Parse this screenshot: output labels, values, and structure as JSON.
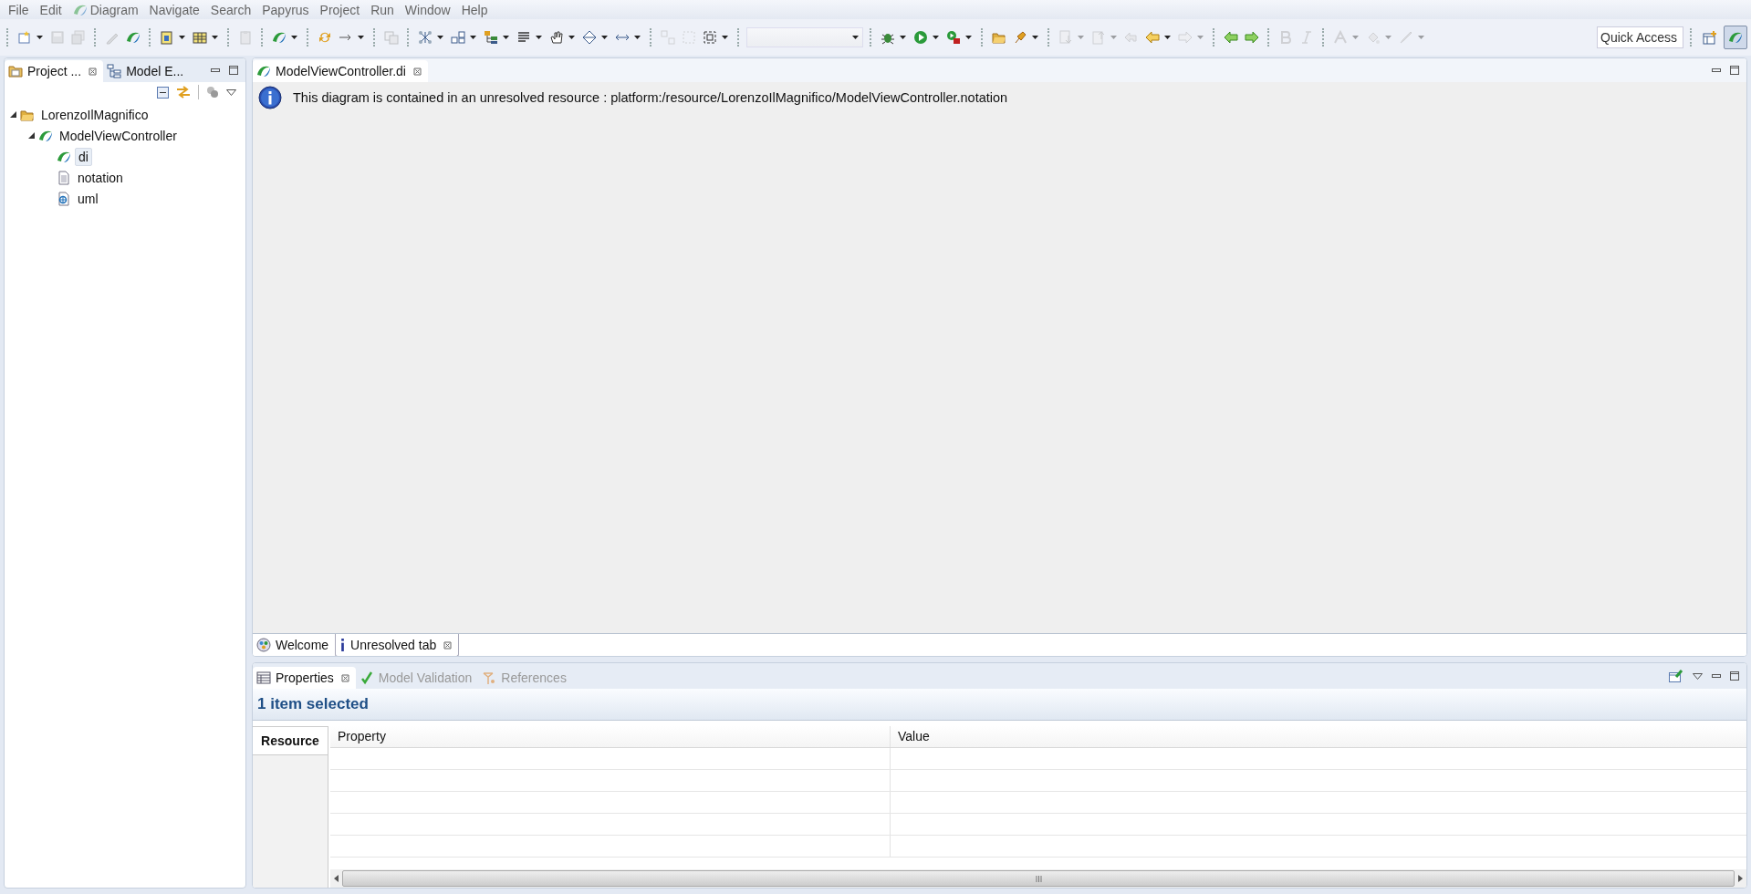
{
  "menu_bar": [
    {
      "label": "File"
    },
    {
      "label": "Edit"
    },
    {
      "label": "Diagram",
      "kind": "papyrus"
    },
    {
      "label": "Navigate"
    },
    {
      "label": "Search"
    },
    {
      "label": "Papyrus"
    },
    {
      "label": "Project"
    },
    {
      "label": "Run"
    },
    {
      "label": "Window"
    },
    {
      "label": "Help"
    }
  ],
  "toolbar": {
    "groups": [
      [
        {
          "kind": "new",
          "dropdown": true,
          "disabled": false
        },
        {
          "kind": "save",
          "dropdown": false,
          "disabled": true
        },
        {
          "kind": "saveall",
          "dropdown": false,
          "disabled": true
        }
      ],
      [
        {
          "kind": "pencil",
          "dropdown": false,
          "disabled": true
        },
        {
          "kind": "papyrus",
          "dropdown": false,
          "disabled": false
        }
      ],
      [
        {
          "kind": "newdiagram",
          "dropdown": true,
          "disabled": false
        },
        {
          "kind": "table",
          "dropdown": true,
          "disabled": false
        }
      ],
      [
        {
          "kind": "clipboard",
          "dropdown": false,
          "disabled": true
        }
      ],
      [
        {
          "kind": "papyrus",
          "dropdown": true,
          "disabled": false
        }
      ],
      [
        {
          "kind": "sync",
          "dropdown": false,
          "disabled": false
        },
        {
          "kind": "arrow",
          "dropdown": true,
          "disabled": false
        }
      ],
      [
        {
          "kind": "copy",
          "dropdown": false,
          "disabled": true
        }
      ],
      [
        {
          "kind": "network",
          "dropdown": true,
          "disabled": false
        },
        {
          "kind": "boxes",
          "dropdown": true,
          "disabled": false
        },
        {
          "kind": "tree",
          "dropdown": true,
          "disabled": false
        },
        {
          "kind": "align",
          "dropdown": true,
          "disabled": false
        },
        {
          "kind": "hand",
          "dropdown": true,
          "disabled": false
        },
        {
          "kind": "diamond",
          "dropdown": true,
          "disabled": false
        },
        {
          "kind": "resize",
          "dropdown": true,
          "disabled": false
        }
      ],
      [
        {
          "kind": "grid",
          "dropdown": false,
          "disabled": true
        },
        {
          "kind": "select",
          "dropdown": false,
          "disabled": true
        },
        {
          "kind": "selectbox",
          "dropdown": true,
          "disabled": false
        }
      ],
      [
        {
          "kind": "combo",
          "dropdown": true,
          "disabled": false
        }
      ],
      [
        {
          "kind": "bug",
          "dropdown": true,
          "disabled": false
        },
        {
          "kind": "run",
          "dropdown": true,
          "disabled": false
        },
        {
          "kind": "runext",
          "dropdown": true,
          "disabled": false
        }
      ],
      [
        {
          "kind": "folder",
          "dropdown": false,
          "disabled": false
        },
        {
          "kind": "pin",
          "dropdown": true,
          "disabled": false
        }
      ],
      [
        {
          "kind": "nextdoc",
          "dropdown": true,
          "disabled": true
        },
        {
          "kind": "prevdoc",
          "dropdown": true,
          "disabled": true
        },
        {
          "kind": "back",
          "dropdown": false,
          "disabled": true
        },
        {
          "kind": "left",
          "dropdown": true,
          "disabled": false
        },
        {
          "kind": "right",
          "dropdown": true,
          "disabled": true
        }
      ],
      [
        {
          "kind": "greenleft",
          "dropdown": false,
          "disabled": false
        },
        {
          "kind": "greenright",
          "dropdown": false,
          "disabled": false
        }
      ],
      [
        {
          "kind": "bold",
          "dropdown": false,
          "disabled": true
        },
        {
          "kind": "italic",
          "dropdown": false,
          "disabled": true
        }
      ],
      [
        {
          "kind": "font",
          "dropdown": true,
          "disabled": true
        },
        {
          "kind": "fill",
          "dropdown": true,
          "disabled": true
        },
        {
          "kind": "line",
          "dropdown": true,
          "disabled": true
        }
      ]
    ],
    "quick_access": {
      "placeholder": "Quick Access"
    },
    "perspectives": [
      {
        "kind": "open",
        "selected": false
      },
      {
        "kind": "papyrus",
        "selected": true
      }
    ]
  },
  "left_panel": {
    "tabs": [
      {
        "label": "Project ...",
        "kind": "project",
        "selected": true
      },
      {
        "label": "Model E...",
        "kind": "model",
        "selected": false
      }
    ],
    "tree": [
      {
        "label": "LorenzoIlMagnifico",
        "kind": "folder",
        "expanded": true,
        "selected": false,
        "children": [
          {
            "label": "ModelViewController",
            "kind": "papyrus",
            "expanded": true,
            "selected": false,
            "children": [
              {
                "label": "di",
                "kind": "papyrus",
                "selected": true
              },
              {
                "label": "notation",
                "kind": "file",
                "selected": false
              },
              {
                "label": "uml",
                "kind": "uml",
                "selected": false
              }
            ]
          }
        ]
      }
    ]
  },
  "editor": {
    "tabs": [
      {
        "label": "ModelViewController.di",
        "kind": "papyrus",
        "selected": true
      }
    ],
    "message": "This diagram is contained in an unresolved resource : platform:/resource/LorenzoIlMagnifico/ModelViewController.notation",
    "bottom_tabs": [
      {
        "label": "Welcome",
        "kind": "welcome",
        "selected": false
      },
      {
        "label": "Unresolved tab",
        "kind": "info",
        "selected": true
      }
    ]
  },
  "properties_panel": {
    "tabs": [
      {
        "label": "Properties",
        "kind": "properties",
        "selected": true
      },
      {
        "label": "Model Validation",
        "kind": "check",
        "selected": false
      },
      {
        "label": "References",
        "kind": "references",
        "selected": false
      }
    ],
    "title": "1 item selected",
    "side_tabs": [
      {
        "label": "Resource",
        "selected": true
      }
    ],
    "table": {
      "columns": [
        "Property",
        "Value"
      ]
    }
  }
}
